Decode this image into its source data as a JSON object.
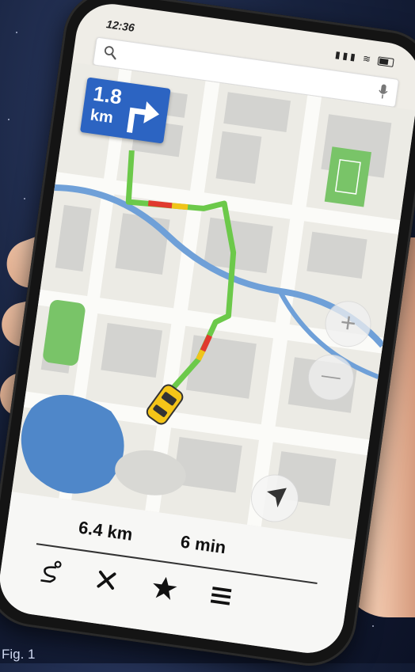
{
  "status_bar": {
    "time": "12:36"
  },
  "search": {
    "value": "",
    "placeholder": ""
  },
  "navigation": {
    "next_turn": {
      "distance": "1.8",
      "unit": "km",
      "direction": "right"
    }
  },
  "trip": {
    "distance": "6.4 km",
    "time": "6 min"
  },
  "map_controls": {
    "zoom_in": "+",
    "zoom_out": "—"
  },
  "bottom_nav": [
    {
      "icon": "route-icon"
    },
    {
      "icon": "close-icon"
    },
    {
      "icon": "star-icon"
    },
    {
      "icon": "menu-icon"
    }
  ],
  "caption": "Fig. 1",
  "colors": {
    "turn_card": "#2c64c2",
    "route": "#6cc94a",
    "traffic_slow": "#f0c419",
    "traffic_jam": "#e03a2e",
    "water": "#4f87c9",
    "park": "#79c468",
    "car": "#f5c518"
  }
}
